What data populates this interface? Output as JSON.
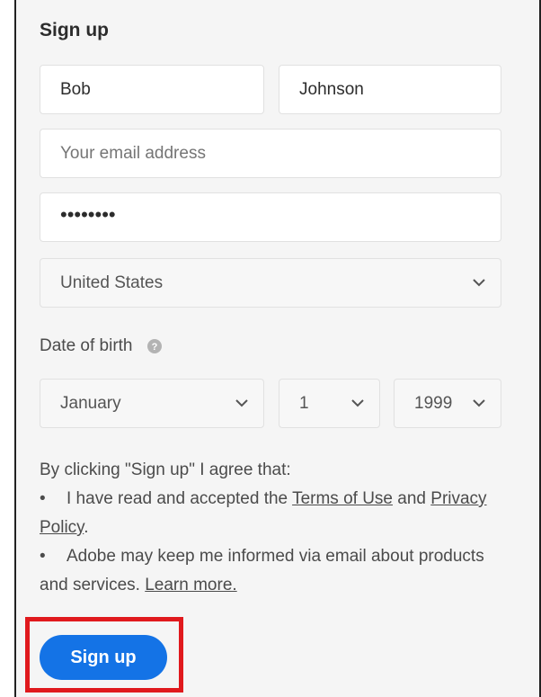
{
  "form": {
    "title": "Sign up",
    "first_name": "Bob",
    "last_name": "Johnson",
    "email_placeholder": "Your email address",
    "password_mask": "••••••••",
    "country": "United States"
  },
  "dob": {
    "label": "Date of birth",
    "month": "January",
    "day": "1",
    "year": "1999"
  },
  "terms": {
    "intro": "By clicking \"Sign up\" I agree that:",
    "bullet1_prefix": "I have read and accepted the ",
    "terms_link": "Terms of Use",
    "bullet1_and": " and",
    "privacy_link": "Privacy Policy",
    "bullet1_suffix": ".",
    "bullet2": "Adobe may keep me informed via email about products and services. ",
    "learn_more_link": "Learn more."
  },
  "buttons": {
    "signup_label": "Sign up"
  },
  "colors": {
    "primary": "#1473e6",
    "highlight": "#e0191d"
  }
}
